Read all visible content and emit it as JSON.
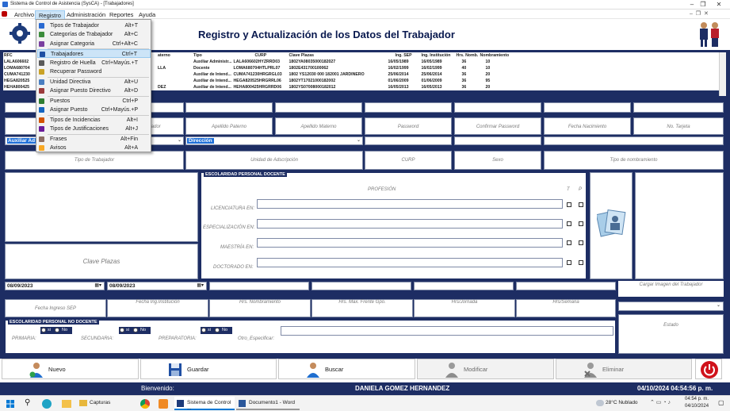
{
  "window": {
    "title": "Sistema de Control de Asistencia (SysCA) - [Trabajadores]"
  },
  "menu": [
    "Archivo",
    "Registro",
    "Administración",
    "Reportes",
    "Ayuda"
  ],
  "dropdown": [
    {
      "label": "Tipos de Trabajador",
      "shortcut": "Alt+T",
      "icon": "worker-type-icon"
    },
    {
      "label": "Categorías de Trabajador",
      "shortcut": "Alt+C",
      "icon": "category-icon"
    },
    {
      "label": "Asignar Categoria",
      "shortcut": "Ctrl+Alt+C",
      "icon": "assign-category-icon"
    },
    {
      "label": "Trabajadores",
      "shortcut": "Ctrl+T",
      "icon": "workers-icon",
      "highlight": true
    },
    {
      "label": "Registro de Huella",
      "shortcut": "Ctrl+Mayús.+T",
      "icon": "fingerprint-icon"
    },
    {
      "label": "Recuperar Password",
      "shortcut": "",
      "icon": "key-icon"
    },
    {
      "label": "Unidad Directiva",
      "shortcut": "Alt+U",
      "icon": "unit-icon"
    },
    {
      "label": "Asignar Puesto Directivo",
      "shortcut": "Alt+D",
      "icon": "assign-post-icon"
    },
    {
      "label": "Puestos",
      "shortcut": "Ctrl+P",
      "icon": "posts-icon"
    },
    {
      "label": "Asignar Puesto",
      "shortcut": "Ctrl+Mayús.+P",
      "icon": "assign-icon"
    },
    {
      "label": "Tipos de Incidencias",
      "shortcut": "Alt+I",
      "icon": "incident-icon"
    },
    {
      "label": "Tipos de Justificaciones",
      "shortcut": "Alt+J",
      "icon": "justify-icon"
    },
    {
      "label": "Frases",
      "shortcut": "Alt+Fin",
      "icon": "phrases-icon"
    },
    {
      "label": "Avisos",
      "shortcut": "Alt+A",
      "icon": "notices-icon"
    }
  ],
  "header": {
    "title": "Registro y Actualización de los Datos del Trabajador"
  },
  "table": {
    "columns": [
      "RFC",
      "aterno",
      "Tipo",
      "CURP",
      "Clave Plazas",
      "Ing. SEP",
      "Ing. Institución",
      "Hrs. Nomb.",
      "Nombramiento"
    ],
    "rows": [
      [
        "LALA606602",
        "",
        "Auxiliar Administr...",
        "LALA606602HYZRRD03",
        "1802YA08035000182027",
        "16/05/1989",
        "16/05/1989",
        "36",
        "10"
      ],
      [
        "LOMA680704",
        "LLA",
        "Docente",
        "LOMA680704HTLPRL07",
        "1802E431700100062",
        "16/02/1999",
        "16/02/1999",
        "40",
        "10"
      ],
      [
        "CUMA741230",
        "",
        "Auxiliar de Intend...",
        "CUMA741230HRGRGL03",
        "1802 YS12030 000 182001  JARDINERO",
        "25/06/2014",
        "25/06/2014",
        "36",
        "20"
      ],
      [
        "HEGA820525",
        "",
        "Auxiliar de Intend...",
        "HEGA820525HRGRRL06",
        "1802YT17021000182002",
        "01/06/2009",
        "01/06/2009",
        "36",
        "95"
      ],
      [
        "HEHA800425",
        "DEZ",
        "Auxiliar de Intend...",
        "HEHA800425HRGRRD06",
        "1802YS07008000182012",
        "16/05/2013",
        "16/05/2013",
        "36",
        "20"
      ]
    ]
  },
  "form": {
    "labels_row1": [
      "Apellido Paterno",
      "Apellido Materno",
      "Password",
      "Confirmar Password",
      "Fecha Nacimiento",
      "No. Tarjeta"
    ],
    "labels_row1_partial": "ajador",
    "select1": "Auxiliar Ad",
    "select2": "Dirección",
    "labels_row2": [
      "Tipo de Trabajador",
      "Unidad de Adscripción",
      "CURP",
      "Sexo",
      "Tipo de nombramiento"
    ],
    "clave_plazas": "Clave Plazas",
    "escolaridad_docente": {
      "title": "ESCOLARIDAD PERSONAL DOCENTE",
      "profesion": "PROFESIÓN",
      "t": "T",
      "p": "P",
      "levels": [
        "LICENCIATURA EN:",
        "ESPECIALIZACIÓN EN:",
        "MAESTRÍA EN:",
        "DOCTORADO EN:"
      ]
    },
    "date1": "08/09/2023",
    "date2": "08/09/2023",
    "labels_row3": [
      "Fecha Ingreso SEP",
      "Fecha Ing.Institución",
      "Hrs. Nombramiento",
      "Hrs. Max. Frente Gpo.",
      "Hrs/Jornada",
      "Hrs/Semana"
    ],
    "cargar_imagen": "Cargar Imagen del Trabajador",
    "estado": "Estado",
    "no_docente": {
      "title": "ESCOLARIDAD PERSONAL NO DOCENTE",
      "si": "si",
      "no": "No",
      "primaria": "PRIMARIA:",
      "secundaria": "SECUNDARIA:",
      "preparatoria": "PREPARATORIA:",
      "otro": "Otro_Especificar:"
    }
  },
  "buttons": {
    "nuevo": "Nuevo",
    "guardar": "Guardar",
    "buscar": "Buscar",
    "modificar": "Modificar",
    "eliminar": "Eliminar"
  },
  "status": {
    "welcome": "Bienvenido:",
    "user": "DANIELA GOMEZ HERNANDEZ",
    "datetime": "04/10/2024 04:54:56 p. m."
  },
  "taskbar": {
    "capturas": "Capturas",
    "app": "Sistema de Control ...",
    "word": "Documento1 - Word",
    "weather": "28°C  Nublado",
    "time": "04:54 p. m.",
    "date": "04/10/2024"
  }
}
